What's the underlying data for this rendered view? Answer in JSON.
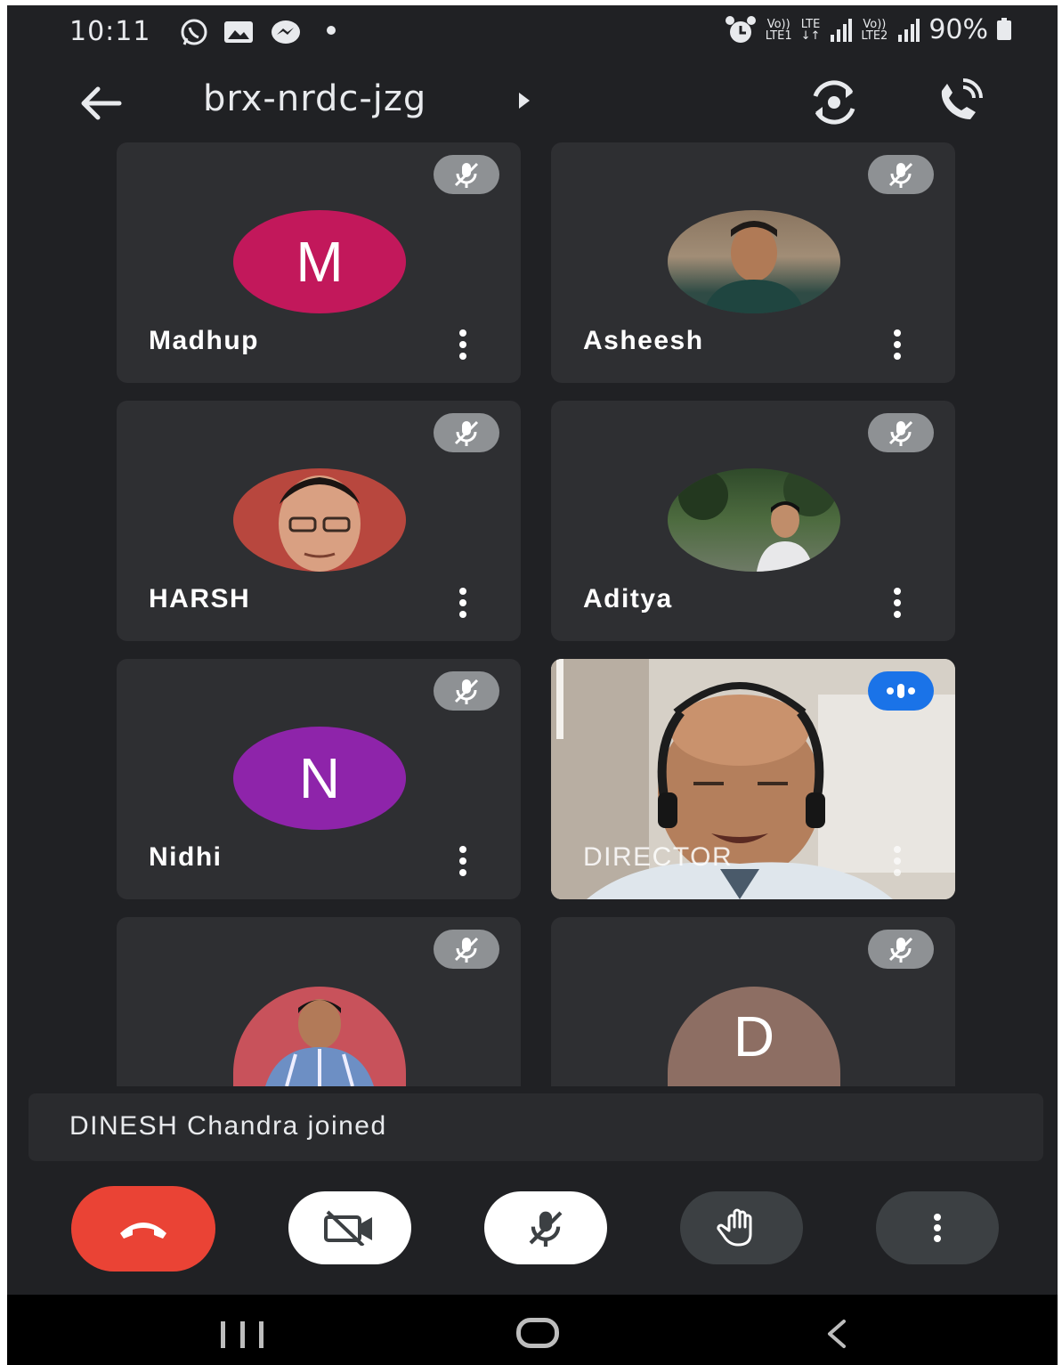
{
  "status_bar": {
    "time": "10:11",
    "left_icons": [
      "whatsapp-icon",
      "gallery-icon",
      "messenger-icon",
      "dot-icon"
    ],
    "right_icons": [
      "alarm-icon",
      "volte1-icon",
      "lte-data-icon",
      "signal1-icon",
      "volte2-icon",
      "signal2-icon"
    ],
    "volte1_label_top": "Vo))",
    "volte1_label_bottom": "LTE1",
    "lte_label_top": "LTE",
    "lte_label_bottom": "↓↑",
    "volte2_label_top": "Vo))",
    "volte2_label_bottom": "LTE2",
    "battery": "90%"
  },
  "app_bar": {
    "meeting_code": "brx-nrdc-jzg"
  },
  "participants": [
    {
      "name": "Madhup",
      "initial": "M",
      "avatar_type": "letter",
      "avatar_color": "#c2185b",
      "muted": true
    },
    {
      "name": "Asheesh",
      "initial": "",
      "avatar_type": "photo",
      "avatar_color": "#7a6a58",
      "muted": true
    },
    {
      "name": "HARSH",
      "initial": "",
      "avatar_type": "photo",
      "avatar_color": "#b8473e",
      "muted": true
    },
    {
      "name": "Aditya",
      "initial": "",
      "avatar_type": "photo",
      "avatar_color": "#3d5a3a",
      "muted": true
    },
    {
      "name": "Nidhi",
      "initial": "N",
      "avatar_type": "letter",
      "avatar_color": "#8e24aa",
      "muted": true
    },
    {
      "name": "DIRECTOR",
      "initial": "",
      "avatar_type": "video",
      "avatar_color": "#c9b9a6",
      "muted": false,
      "speaking": true
    },
    {
      "name": "",
      "initial": "",
      "avatar_type": "photo",
      "avatar_color": "#c8525b",
      "muted": true
    },
    {
      "name": "",
      "initial": "D",
      "avatar_type": "letter",
      "avatar_color": "#8d6e63",
      "muted": true
    }
  ],
  "notification": "DINESH Chandra joined",
  "controls": [
    {
      "name": "end-call",
      "icon": "hang-up-icon",
      "color": "#ea4335"
    },
    {
      "name": "camera-toggle",
      "icon": "video-off-icon",
      "color": "#ffffff"
    },
    {
      "name": "mic-toggle",
      "icon": "mic-off-icon",
      "color": "#ffffff"
    },
    {
      "name": "raise-hand",
      "icon": "hand-icon",
      "color": "#3c4043"
    },
    {
      "name": "more-options",
      "icon": "more-vert-icon",
      "color": "#3c4043"
    }
  ],
  "nav_bar": [
    "recent-apps",
    "home",
    "back"
  ]
}
